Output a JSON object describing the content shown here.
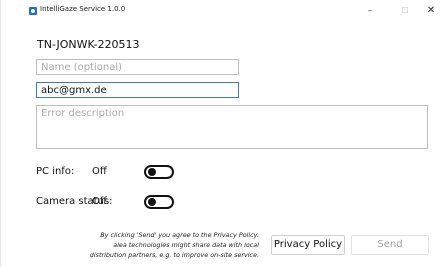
{
  "window": {
    "title": "IntelliGaze Service 1.0.0",
    "minimize_glyph": "–",
    "maximize_glyph": "☐",
    "close_glyph": "✕"
  },
  "form": {
    "device_id": "TN-JONWK-220513",
    "name": {
      "value": "",
      "placeholder": "Name (optional)"
    },
    "email": {
      "value": "abc@gmx.de",
      "placeholder": ""
    },
    "error": {
      "value": "",
      "placeholder": "Error description"
    }
  },
  "settings": {
    "pc_info": {
      "label": "PC info:",
      "state": "Off",
      "enabled": false
    },
    "camera_status": {
      "label": "Camera status:",
      "state": "Off",
      "enabled": false
    }
  },
  "footer": {
    "disclaimer_line1": "By clicking 'Send' you agree to the Privacy Policy.",
    "disclaimer_line2": "alea technologies might share data with local",
    "disclaimer_line3": "distribution partners, e.g. to improve on-site service.",
    "privacy_button": "Privacy Policy",
    "send_button": "Send"
  },
  "colors": {
    "accent_border": "#3d79c4",
    "app_icon": "#1d6fd6",
    "disabled_text": "#a0a0a0"
  }
}
